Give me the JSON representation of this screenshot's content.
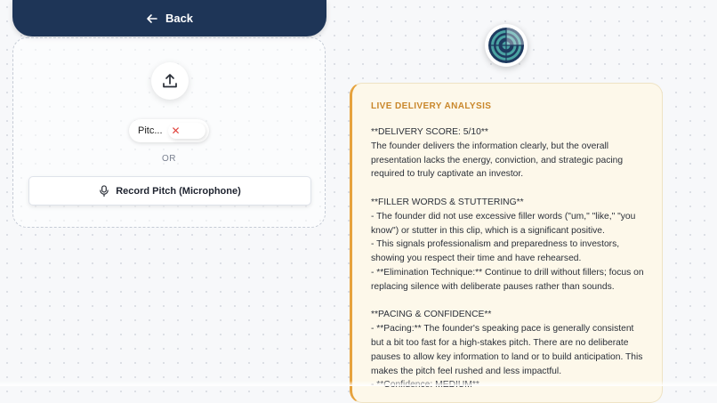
{
  "nav": {
    "back_label": "Back",
    "back_icon": "arrow-left-icon"
  },
  "upload": {
    "icon": "upload-icon",
    "file_name": "Pitc...",
    "remove_icon": "close-icon",
    "remove_symbol": "✕",
    "divider_text": "OR",
    "record_label": "Record Pitch (Microphone)",
    "record_icon": "microphone-icon"
  },
  "logo": {
    "icon": "radar-logo-icon",
    "colors": [
      "#1e3a5f",
      "#4aa3a3",
      "#ffffff"
    ]
  },
  "analysis": {
    "title": "LIVE DELIVERY ANALYSIS",
    "body": "**DELIVERY SCORE: 5/10**\nThe founder delivers the information clearly, but the overall presentation lacks the energy, conviction, and strategic pacing required to truly captivate an investor.\n\n**FILLER WORDS & STUTTERING**\n- The founder did not use excessive filler words (\"um,\" \"like,\" \"you know\") or stutter in this clip, which is a significant positive.\n- This signals professionalism and preparedness to investors, showing you respect their time and have rehearsed.\n- **Elimination Technique:** Continue to drill without fillers; focus on replacing silence with deliberate pauses rather than sounds.\n\n**PACING & CONFIDENCE**\n- **Pacing:** The founder's speaking pace is generally consistent but a bit too fast for a high-stakes pitch. There are no deliberate pauses to allow key information to land or to build anticipation. This makes the pitch feel rushed and less impactful.\n- **Confidence: MEDIUM**",
    "accent_color": "#e6a23c"
  }
}
